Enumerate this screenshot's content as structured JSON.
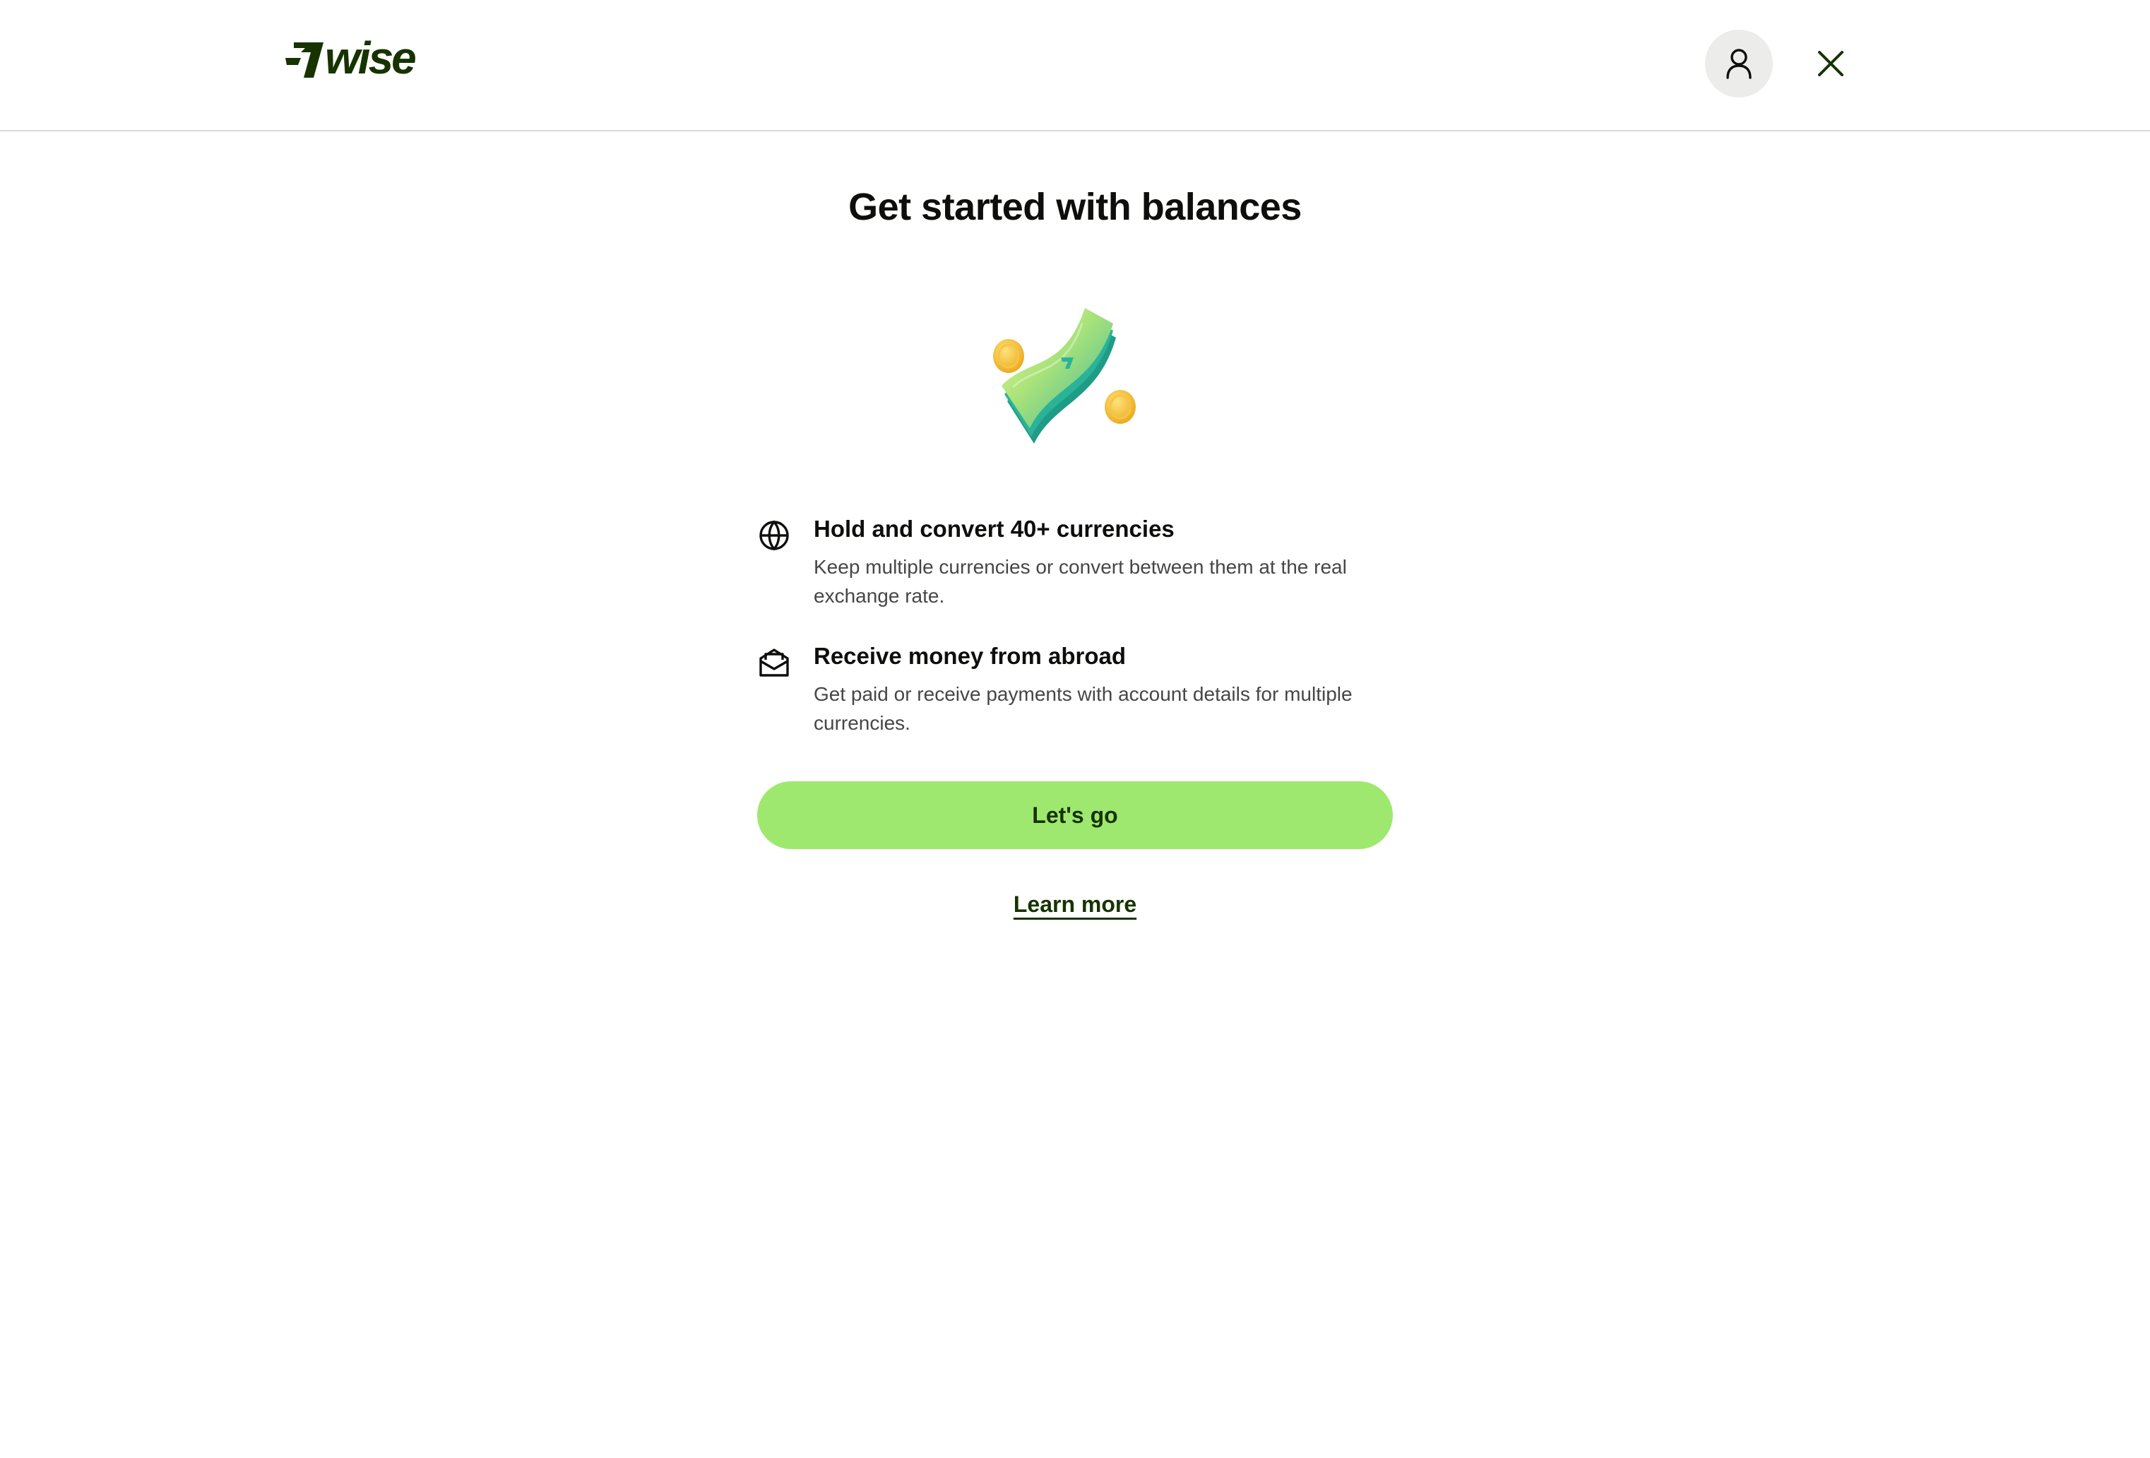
{
  "header": {
    "logo_text": "wise",
    "profile_icon": "user-icon",
    "close_icon": "close-icon"
  },
  "main": {
    "title": "Get started with balances",
    "illustration": "money-stack-illustration",
    "features": [
      {
        "icon": "globe-icon",
        "heading": "Hold and convert 40+ currencies",
        "description": "Keep multiple currencies or convert between them at the real exchange rate."
      },
      {
        "icon": "envelope-icon",
        "heading": "Receive money from abroad",
        "description": "Get paid or receive payments with account details for multiple currencies."
      }
    ],
    "primary_button": "Let's go",
    "secondary_link": "Learn more"
  },
  "colors": {
    "brand_dark": "#163300",
    "brand_green": "#9fe870",
    "text_primary": "#0e0f0c",
    "text_secondary": "#454745",
    "avatar_bg": "#ececeb",
    "divider": "#d9d9d9"
  }
}
